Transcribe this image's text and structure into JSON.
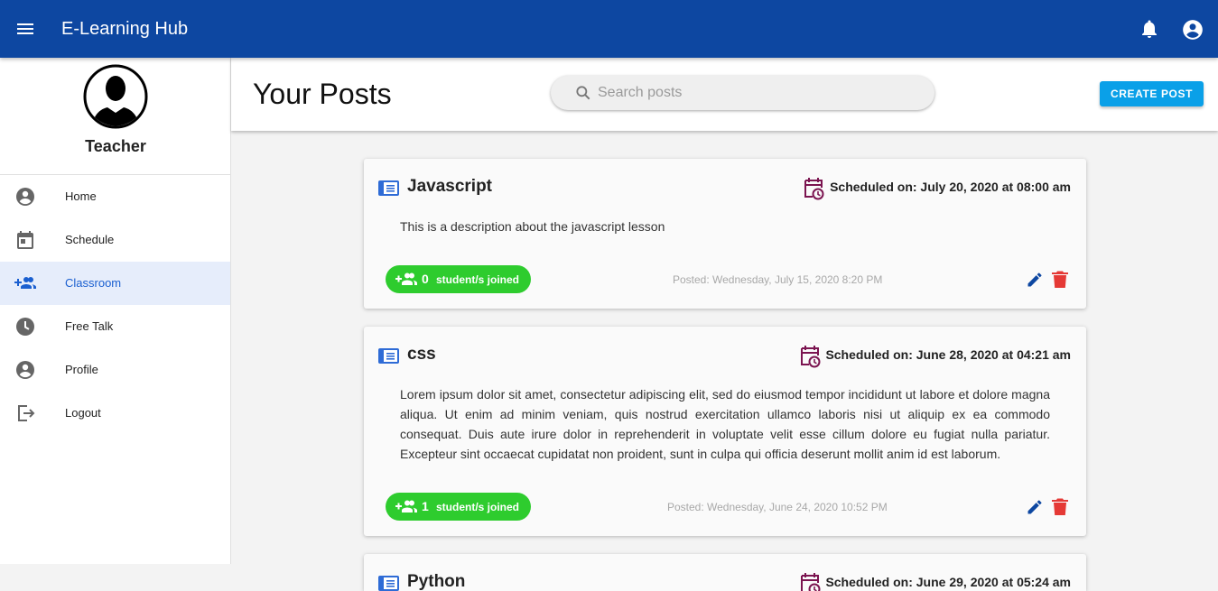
{
  "app": {
    "title": "E-Learning Hub"
  },
  "icons": {
    "menu": "menu-icon",
    "notifications": "bell-icon",
    "account": "account-circle-icon",
    "search": "search-icon",
    "book": "book-icon",
    "calendar_clock": "calendar-clock-icon",
    "group_add": "group-add-icon",
    "edit": "pencil-icon",
    "delete": "trash-icon"
  },
  "colors": {
    "appbar": "#0d47a1",
    "accent": "#1a5fd0",
    "create_button": "#0aa0e8",
    "joined_badge": "#2ecc2e",
    "delete": "#e53935",
    "calendar": "#7b1450"
  },
  "profile": {
    "role": "Teacher"
  },
  "nav": {
    "items": [
      {
        "label": "Home",
        "icon": "account-circle-icon",
        "active": false
      },
      {
        "label": "Schedule",
        "icon": "calendar-icon",
        "active": false
      },
      {
        "label": "Classroom",
        "icon": "group-add-icon",
        "active": true
      },
      {
        "label": "Free Talk",
        "icon": "clock-icon",
        "active": false
      },
      {
        "label": "Profile",
        "icon": "account-circle-icon",
        "active": false
      },
      {
        "label": "Logout",
        "icon": "logout-icon",
        "active": false
      }
    ]
  },
  "header": {
    "title": "Your Posts",
    "search_placeholder": "Search posts",
    "create_label": "CREATE POST"
  },
  "posts": [
    {
      "title": "Javascript",
      "scheduled": "Scheduled on: July 20, 2020 at 08:00 am",
      "description": "This is a description about the javascript lesson",
      "joined_count": "0",
      "joined_label": "student/s joined",
      "posted": "Posted: Wednesday, July 15, 2020 8:20 PM"
    },
    {
      "title": "css",
      "scheduled": "Scheduled on: June 28, 2020 at 04:21 am",
      "description": "Lorem ipsum dolor sit amet, consectetur adipiscing elit, sed do eiusmod tempor incididunt ut labore et dolore magna aliqua. Ut enim ad minim veniam, quis nostrud exercitation ullamco laboris nisi ut aliquip ex ea commodo consequat. Duis aute irure dolor in reprehenderit in voluptate velit esse cillum dolore eu fugiat nulla pariatur. Excepteur sint occaecat cupidatat non proident, sunt in culpa qui officia deserunt mollit anim id est laborum.",
      "joined_count": "1",
      "joined_label": "student/s joined",
      "posted": "Posted: Wednesday, June 24, 2020 10:52 PM"
    },
    {
      "title": "Python",
      "scheduled": "Scheduled on: June 29, 2020 at 05:24 am"
    }
  ]
}
